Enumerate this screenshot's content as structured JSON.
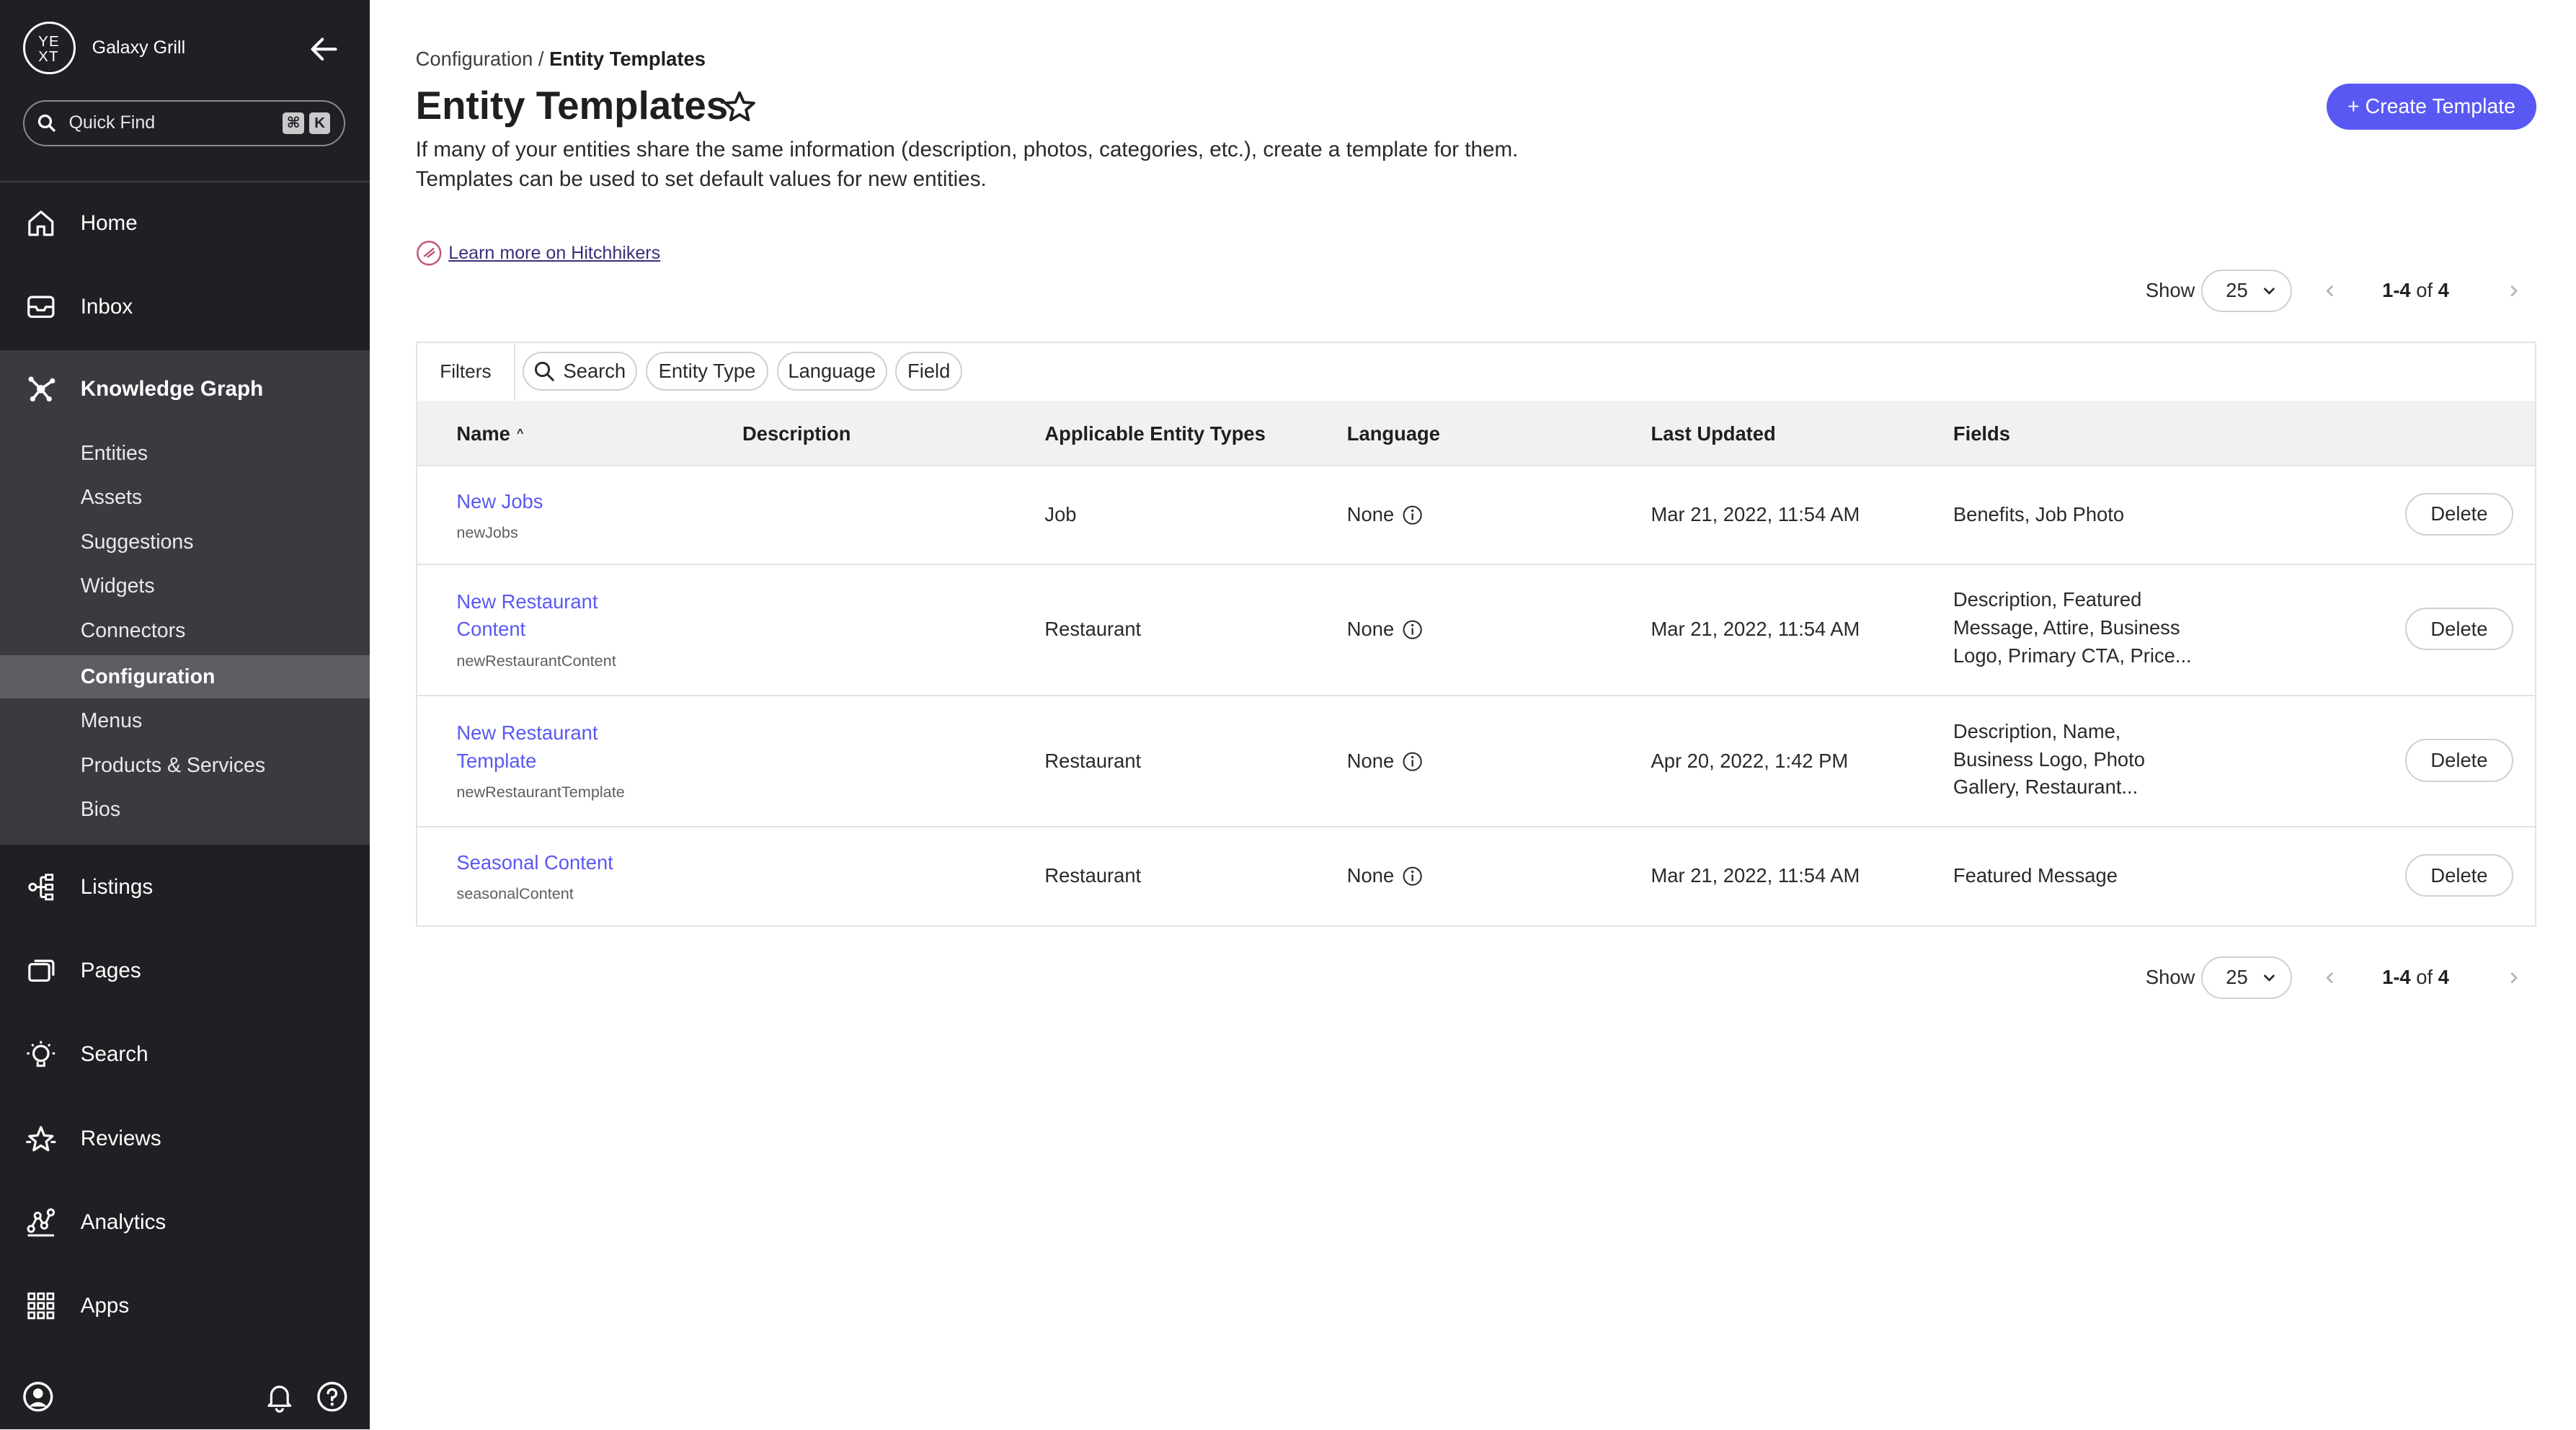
{
  "sidebar": {
    "brand_logo_top": "YE",
    "brand_logo_bottom": "XT",
    "brand_name": "Galaxy Grill",
    "quick_find": {
      "label": "Quick Find",
      "key_cmd": "⌘",
      "key_k": "K"
    },
    "nav": {
      "home": "Home",
      "inbox": "Inbox",
      "knowledge_graph": "Knowledge Graph",
      "listings": "Listings",
      "pages": "Pages",
      "search": "Search",
      "reviews": "Reviews",
      "analytics": "Analytics",
      "apps": "Apps"
    },
    "kg_sub": [
      "Entities",
      "Assets",
      "Suggestions",
      "Widgets",
      "Connectors",
      "Configuration",
      "Menus",
      "Products & Services",
      "Bios"
    ],
    "active_sub": "Configuration"
  },
  "breadcrumb": {
    "parent": "Configuration",
    "sep": " / ",
    "current": "Entity Templates"
  },
  "page": {
    "title": "Entity Templates",
    "description_line1": "If many of your entities share the same information (description, photos, categories, etc.), create a template for them.",
    "description_line2": "Templates can be used to set default values for new entities.",
    "create_button": "+ Create Template",
    "learn_more": "Learn more on Hitchhikers"
  },
  "pagination": {
    "show_label": "Show",
    "page_size": "25",
    "range": "1-4",
    "of": "of",
    "total": "4"
  },
  "filters": {
    "label": "Filters",
    "search": "Search",
    "entity_type": "Entity Type",
    "language": "Language",
    "field": "Field"
  },
  "table": {
    "columns": [
      "Name",
      "Description",
      "Applicable Entity Types",
      "Language",
      "Last Updated",
      "Fields"
    ],
    "sort_indicator": "^",
    "delete_label": "Delete",
    "rows": [
      {
        "name": "New Jobs",
        "id": "newJobs",
        "description": "",
        "entity_types": "Job",
        "language": "None",
        "last_updated": "Mar 21, 2022, 11:54 AM",
        "fields": "Benefits, Job Photo"
      },
      {
        "name": "New Restaurant Content",
        "id": "newRestaurantContent",
        "description": "",
        "entity_types": "Restaurant",
        "language": "None",
        "last_updated": "Mar 21, 2022, 11:54 AM",
        "fields": "Description, Featured Message, Attire, Business Logo, Primary CTA, Price..."
      },
      {
        "name": "New Restaurant Template",
        "id": "newRestaurantTemplate",
        "description": "",
        "entity_types": "Restaurant",
        "language": "None",
        "last_updated": "Apr 20, 2022, 1:42 PM",
        "fields": "Description, Name, Business Logo, Photo Gallery, Restaurant..."
      },
      {
        "name": "Seasonal Content",
        "id": "seasonalContent",
        "description": "",
        "entity_types": "Restaurant",
        "language": "None",
        "last_updated": "Mar 21, 2022, 11:54 AM",
        "fields": "Featured Message"
      }
    ]
  },
  "colors": {
    "sidebar_bg": "#1f2023",
    "section_bg": "#3a3b40",
    "active_bg": "#5d5e63",
    "accent": "#5a58f2",
    "link": "#5a58f2"
  }
}
